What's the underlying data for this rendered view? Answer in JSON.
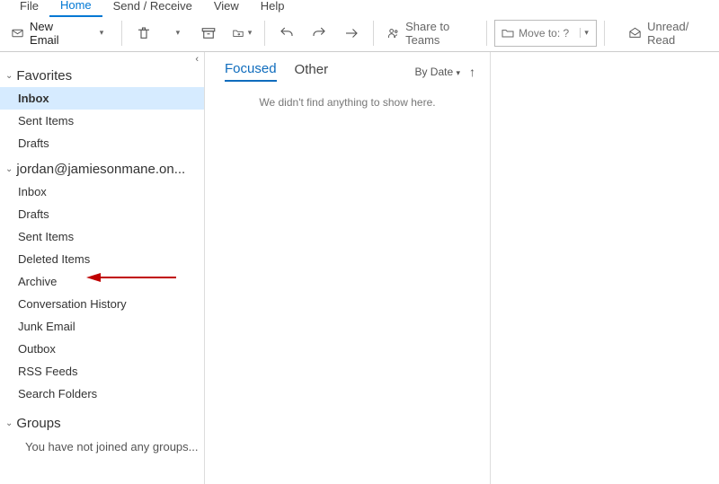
{
  "tabs": {
    "file": "File",
    "home": "Home",
    "sendrecv": "Send / Receive",
    "view": "View",
    "help": "Help"
  },
  "ribbon": {
    "new_email": "New Email",
    "share_teams": "Share to Teams",
    "move_to_placeholder": "Move to: ?",
    "unread_read": "Unread/ Read"
  },
  "sidebar": {
    "favorites_label": "Favorites",
    "favorites": [
      "Inbox",
      "Sent Items",
      "Drafts"
    ],
    "account": "jordan@jamiesonmane.on...",
    "account_folders": [
      "Inbox",
      "Drafts",
      "Sent Items",
      "Deleted Items",
      "Archive",
      "Conversation History",
      "Junk Email",
      "Outbox",
      "RSS Feeds",
      "Search Folders"
    ],
    "groups_label": "Groups",
    "groups_empty": "You have not joined any groups..."
  },
  "list": {
    "focused": "Focused",
    "other": "Other",
    "sort": "By Date",
    "empty": "We didn't find anything to show here."
  }
}
